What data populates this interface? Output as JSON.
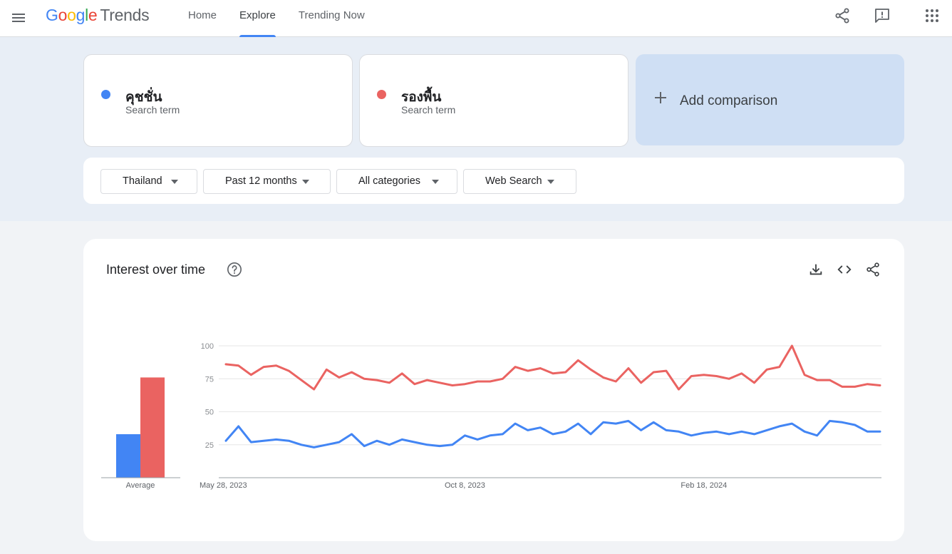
{
  "header": {
    "logo": {
      "google": "Google",
      "product": "Trends"
    },
    "nav": [
      {
        "label": "Home"
      },
      {
        "label": "Explore",
        "active": true
      },
      {
        "label": "Trending Now"
      }
    ],
    "icons": [
      "menu-icon",
      "share-icon",
      "feedback-icon",
      "apps-icon"
    ]
  },
  "terms": [
    {
      "name": "คุชชั่น",
      "subtitle": "Search term",
      "color": "#4285f4"
    },
    {
      "name": "รองพื้น",
      "subtitle": "Search term",
      "color": "#ea6361"
    }
  ],
  "add_comparison": {
    "label": "Add comparison"
  },
  "filters": [
    {
      "label": "Thailand"
    },
    {
      "label": "Past 12 months"
    },
    {
      "label": "All categories"
    },
    {
      "label": "Web Search"
    }
  ],
  "chart_card": {
    "title": "Interest over time",
    "icons": [
      "help-icon",
      "download-icon",
      "embed-icon",
      "share-icon"
    ]
  },
  "chart_data": {
    "type": "line",
    "title": "Interest over time",
    "ylim": [
      0,
      100
    ],
    "yticks": [
      25,
      50,
      75,
      100
    ],
    "x_tick_labels": [
      {
        "label": "May 28, 2023",
        "index": 0
      },
      {
        "label": "Oct 8, 2023",
        "index": 19
      },
      {
        "label": "Feb 18, 2024",
        "index": 38
      }
    ],
    "grid": true,
    "series": [
      {
        "name": "คุชชั่น",
        "color": "#4285f4",
        "average": 33,
        "values": [
          28,
          39,
          27,
          28,
          29,
          28,
          25,
          23,
          25,
          27,
          33,
          24,
          28,
          25,
          29,
          27,
          25,
          24,
          25,
          32,
          29,
          32,
          33,
          41,
          36,
          38,
          33,
          35,
          41,
          33,
          42,
          41,
          43,
          36,
          42,
          36,
          35,
          32,
          34,
          35,
          33,
          35,
          33,
          36,
          39,
          41,
          35,
          32,
          43,
          42,
          40,
          35,
          35
        ]
      },
      {
        "name": "รองพื้น",
        "color": "#ea6361",
        "average": 76,
        "values": [
          86,
          85,
          78,
          84,
          85,
          81,
          74,
          67,
          82,
          76,
          80,
          75,
          74,
          72,
          79,
          71,
          74,
          72,
          70,
          71,
          73,
          73,
          75,
          84,
          81,
          83,
          79,
          80,
          89,
          82,
          76,
          73,
          83,
          72,
          80,
          81,
          67,
          77,
          78,
          77,
          75,
          79,
          72,
          82,
          84,
          100,
          78,
          74,
          74,
          69,
          69,
          71,
          70
        ]
      }
    ],
    "average_label": "Average"
  }
}
